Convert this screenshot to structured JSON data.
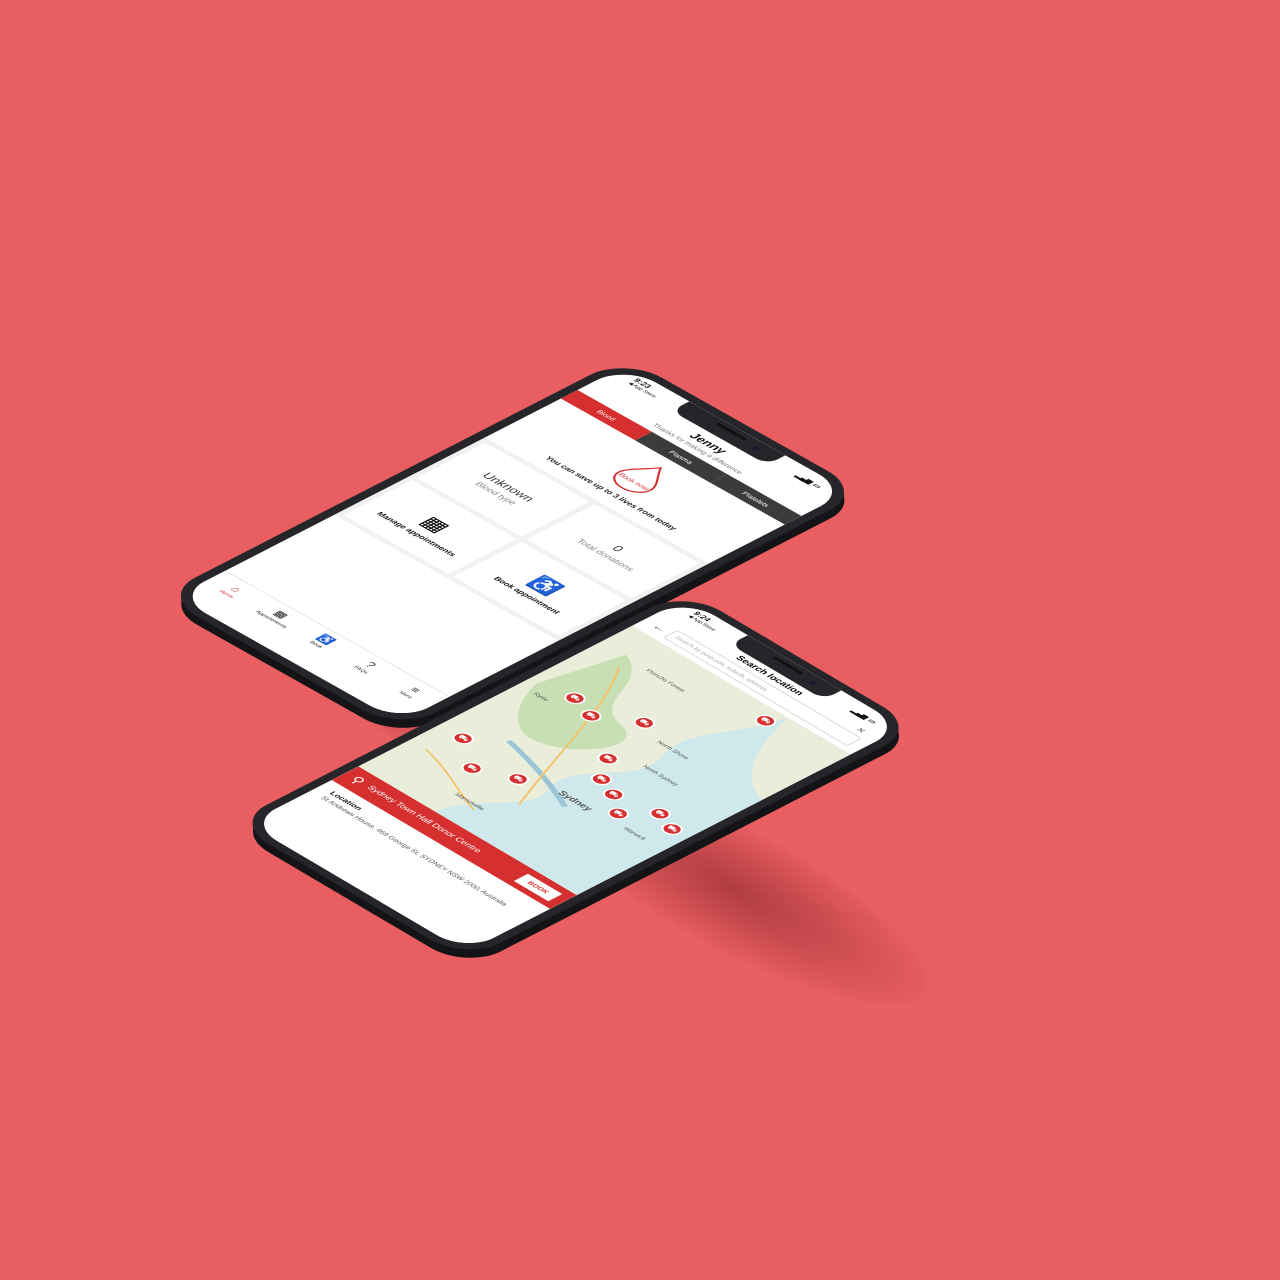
{
  "home_phone": {
    "status": {
      "time": "9:23",
      "back_app": "◀ App Store"
    },
    "greeting": {
      "name": "Jenny",
      "subtitle": "Thanks for making a difference"
    },
    "tabs": [
      {
        "label": "Blood"
      },
      {
        "label": "Plasma"
      },
      {
        "label": "Platelets"
      }
    ],
    "hero": {
      "button_label": "Book now",
      "message": "You can save up to 3 lives from today"
    },
    "tiles": {
      "blood_type_value": "Unknown",
      "blood_type_label": "Blood type",
      "donations_value": "0",
      "donations_label": "Total donations",
      "manage_label": "Manage appointments",
      "book_label": "Book appointment"
    },
    "tabbar": [
      {
        "label": "Home"
      },
      {
        "label": "Appointments"
      },
      {
        "label": "Book"
      },
      {
        "label": "FAQs"
      },
      {
        "label": "More"
      }
    ],
    "brand_color": "#d62f2f"
  },
  "map_phone": {
    "status": {
      "time": "9:24",
      "back_app": "◀ App Store"
    },
    "title": "Search location",
    "search": {
      "placeholder": "Search by postcode, suburb, address"
    },
    "map_labels": [
      "Frenchs Forest",
      "Ryde",
      "North Shore",
      "North Sydney",
      "Sydney",
      "Warwick",
      "Marrickville"
    ],
    "location_card": {
      "name": "Sydney Town Hall Donor Centre",
      "book_label": "BOOK",
      "location_label": "Location",
      "address": "St Andrews House, 469 George St, SYDNEY NSW 2000, Australia"
    }
  }
}
